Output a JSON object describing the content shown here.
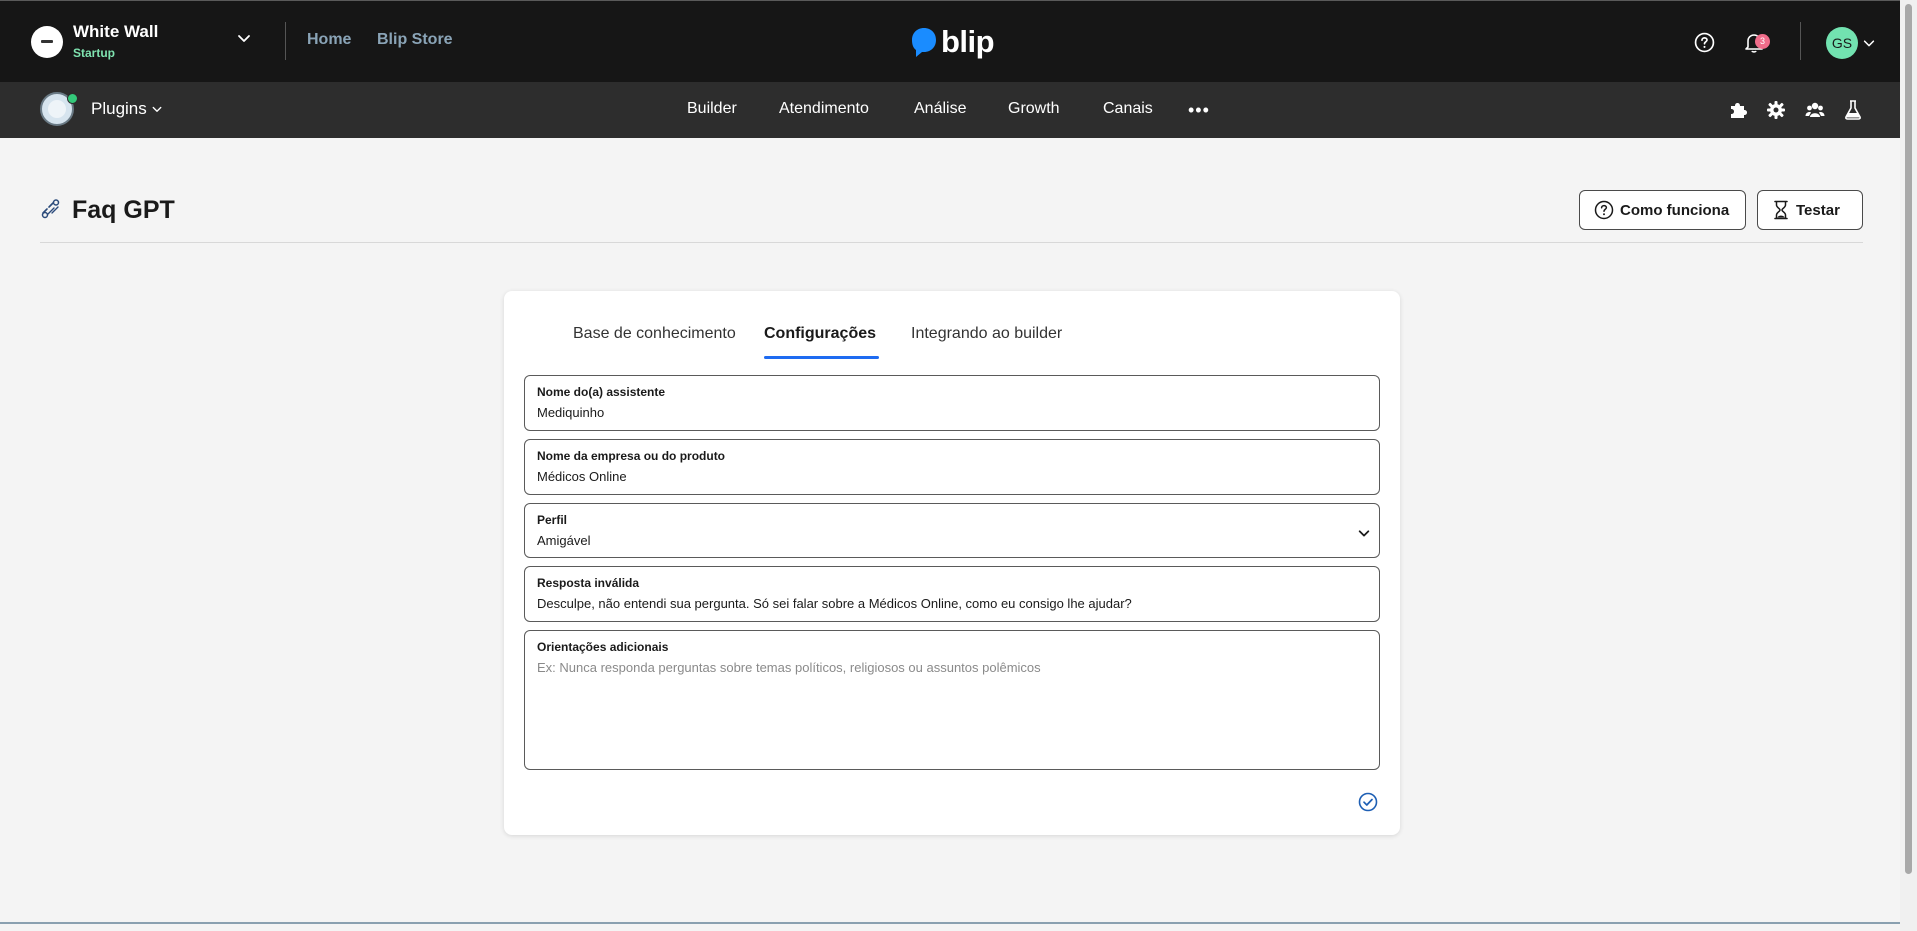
{
  "topbar": {
    "org_name": "White Wall",
    "org_plan": "Startup",
    "links": [
      "Home",
      "Blip Store"
    ],
    "brand": "blip",
    "notification_count": "3",
    "avatar_initials": "GS"
  },
  "navbar": {
    "plugins_label": "Plugins",
    "items": [
      "Builder",
      "Atendimento",
      "Análise",
      "Growth",
      "Canais"
    ],
    "more_label": "•••"
  },
  "page": {
    "title": "Faq GPT",
    "how_it_works_label": "Como funciona",
    "test_label": "Testar"
  },
  "tabs": [
    {
      "label": "Base de conhecimento",
      "active": false
    },
    {
      "label": "Configurações",
      "active": true
    },
    {
      "label": "Integrando ao builder",
      "active": false
    }
  ],
  "form": {
    "assistant_name": {
      "label": "Nome do(a) assistente",
      "value": "Mediquinho"
    },
    "company_name": {
      "label": "Nome da empresa ou do produto",
      "value": "Médicos Online"
    },
    "profile": {
      "label": "Perfil",
      "value": "Amigável"
    },
    "invalid_response": {
      "label": "Resposta inválida",
      "value": "Desculpe, não entendi sua pergunta. Só sei falar sobre a Médicos Online, como eu consigo lhe ajudar?"
    },
    "additional_guidelines": {
      "label": "Orientações adicionais",
      "placeholder": "Ex: Nunca responda perguntas sobre temas políticos, religiosos ou assuntos polêmicos"
    }
  },
  "colors": {
    "topbar_bg": "#161616",
    "navbar_bg": "#2d2d2d",
    "accent_blue": "#1e6bf1",
    "brand_blue": "#1a8cff",
    "avatar_green": "#72e2b0",
    "badge_pink": "#f06c8a"
  }
}
